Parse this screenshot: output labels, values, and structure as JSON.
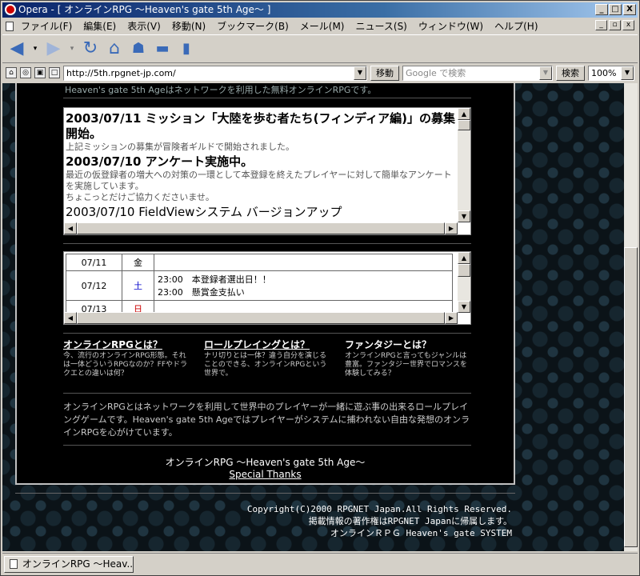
{
  "window": {
    "title": "Opera - [ オンラインRPG ～Heaven's gate 5th Age～ ]",
    "minimize": "_",
    "maximize": "□",
    "close": "X"
  },
  "menu": [
    "ファイル(F)",
    "編集(E)",
    "表示(V)",
    "移動(N)",
    "ブックマーク(B)",
    "メール(M)",
    "ニュース(S)",
    "ウィンドウ(W)",
    "ヘルプ(H)"
  ],
  "address": {
    "url": "http://5th.rpgnet-jp.com/",
    "go_label": "移動",
    "search_placeholder": "Google で検索",
    "search_label": "検索",
    "zoom": "100%"
  },
  "page": {
    "intro_line": "Heaven's gate 5th Ageはネットワークを利用した無料オンラインRPGです。",
    "news": [
      {
        "title": "2003/07/11 ミッション「大陸を歩む者たち(フィンディア編)」の募集開始。",
        "body": [
          "上記ミッションの募集が冒険者ギルドで開始されました。"
        ]
      },
      {
        "title": "2003/07/10 アンケート実施中。",
        "body": [
          "最近の仮登録者の増大への対策の一環として本登録を終えたプレイヤーに対して簡単なアンケートを実施しています。",
          "ちょこっとだけご協力くださいませ。"
        ]
      },
      {
        "title": "2003/07/10 FieldViewシステム バージョンアップ",
        "body": []
      }
    ],
    "schedule": [
      {
        "date": "07/11",
        "day": "金",
        "events": []
      },
      {
        "date": "07/12",
        "day": "土",
        "events": [
          "23:00　本登録者選出日！！",
          "23:00　懸賞金支払い"
        ]
      },
      {
        "date": "07/13",
        "day": "日",
        "events": []
      }
    ],
    "links": [
      {
        "title": "オンラインRPGとは？",
        "text": "今、流行のオンラインRPG形態。それは一体どういうRPGなのか？FFやドラクエとの違いは何？"
      },
      {
        "title": "ロールプレイングとは？",
        "text": "ナリ切りとは一体？違う自分を演じることのできる、オンラインRPGという世界で。"
      },
      {
        "title": "ファンタジーとは？",
        "text": "オンラインRPGと言ってもジャンルは豊富。ファンタジー世界でロマンスを体験してみる？"
      }
    ],
    "about": "オンラインRPGとはネットワークを利用して世界中のプレイヤーが一緒に遊ぶ事の出来るロールプレイングゲームです。Heaven's gate 5th Ageではプレイヤーがシステムに捕われない自由な発想のオンラインRPGを心がけています。",
    "footer_title": "オンラインRPG ～Heaven's gate 5th Age～",
    "special_thanks": "Special Thanks",
    "copyright_lines": [
      "Copyright(C)2000 RPGNET Japan.All Rights Reserved.",
      "掲載情報の著作権はRPGNET Japanに帰属します。",
      "オンラインＲＰＧ Heaven's gate SYSTEM"
    ]
  },
  "tab": {
    "label": "オンラインRPG ～Heav..."
  }
}
